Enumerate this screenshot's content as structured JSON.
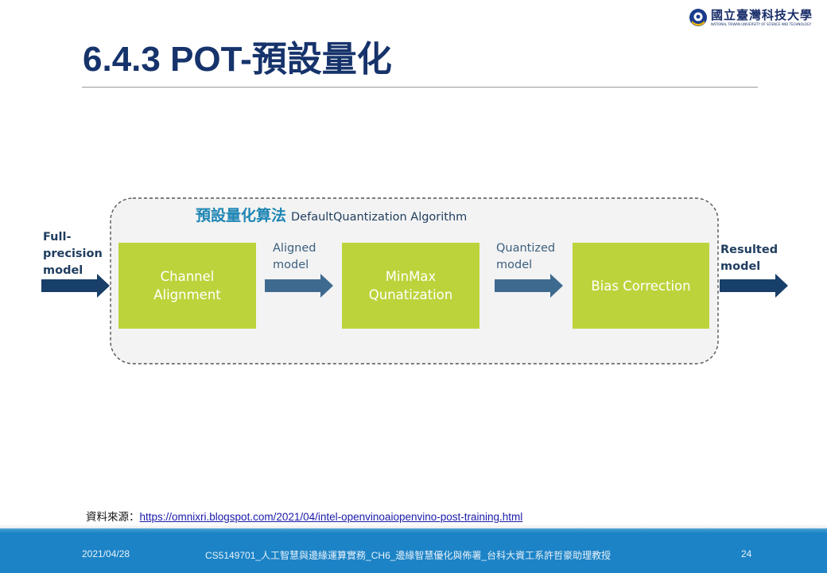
{
  "header": {
    "logo_cn": "國立臺灣科技大學",
    "logo_en": "NATIONAL TAIWAN UNIVERSITY OF SCIENCE AND TECHNOLOGY",
    "title": "6.4.3 POT-預設量化"
  },
  "diagram": {
    "algorithm_title_cn": "預設量化算法",
    "algorithm_title_en": "DefaultQuantization Algorithm",
    "input_label": [
      "Full-",
      "precision",
      "model"
    ],
    "steps": [
      {
        "lines": [
          "Channel",
          "Alignment"
        ]
      },
      {
        "lines": [
          "MinMax",
          "Qunatization"
        ]
      },
      {
        "lines": [
          "Bias Correction"
        ]
      }
    ],
    "aligned_label": [
      "Aligned",
      "model"
    ],
    "quantized_label": [
      "Quantized",
      "model"
    ],
    "output_label": [
      "Resulted",
      "model"
    ],
    "colors": {
      "box": "#bdd33b",
      "arrow_dark": "#183f6a",
      "arrow_mid": "#3f6a90",
      "container_fill": "#f3f3f3",
      "accent": "#1e86b4"
    }
  },
  "source": {
    "prefix": "資料來源：",
    "url": "https://omnixri.blogspot.com/2021/04/intel-openvinoaiopenvino-post-training.html"
  },
  "footer": {
    "date": "2021/04/28",
    "course": "CS5149701_人工智慧與邊緣運算實務_CH6_邊緣智慧優化與佈署_台科大資工系許哲豪助理教授",
    "page": "24"
  }
}
